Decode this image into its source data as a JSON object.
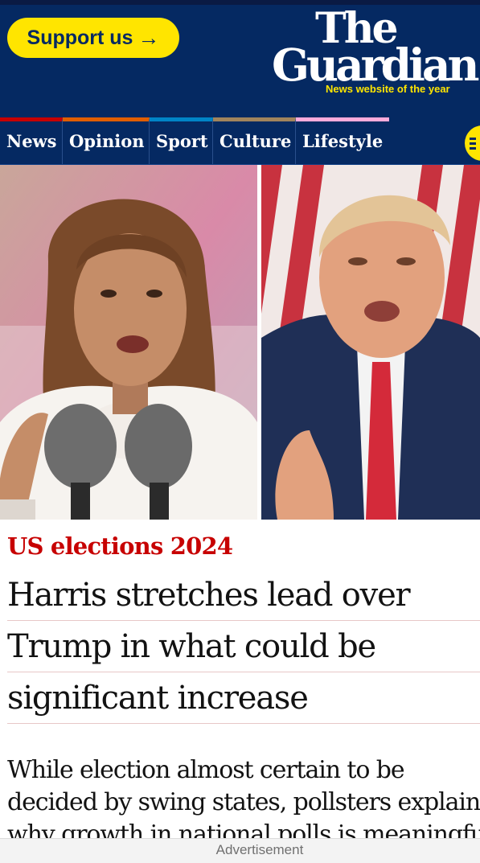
{
  "header": {
    "support_label": "Support us",
    "support_arrow": "→",
    "logo_line1": "The",
    "logo_line2": "Guardian",
    "tagline": "News website of the year"
  },
  "nav": {
    "items": [
      {
        "label": "News",
        "color": "#c70000"
      },
      {
        "label": "Opinion",
        "color": "#e05e00"
      },
      {
        "label": "Sport",
        "color": "#0084c6"
      },
      {
        "label": "Culture",
        "color": "#a1845c"
      },
      {
        "label": "Lifestyle",
        "color": "#ffabdb"
      }
    ],
    "menu_icon": "hamburger-menu-icon"
  },
  "article": {
    "kicker": "US elections 2024",
    "headline_lines": [
      "Harris stretches lead over",
      "Trump in what could be",
      "significant increase"
    ],
    "standfirst_lines": [
      "While election almost certain to be",
      "decided by swing states, pollsters explain",
      "why growth in national polls is meaningful"
    ]
  },
  "ad": {
    "label": "Advertisement"
  },
  "colors": {
    "brand_blue": "#052962",
    "support_yellow": "#ffe500",
    "kicker_red": "#c70000"
  }
}
